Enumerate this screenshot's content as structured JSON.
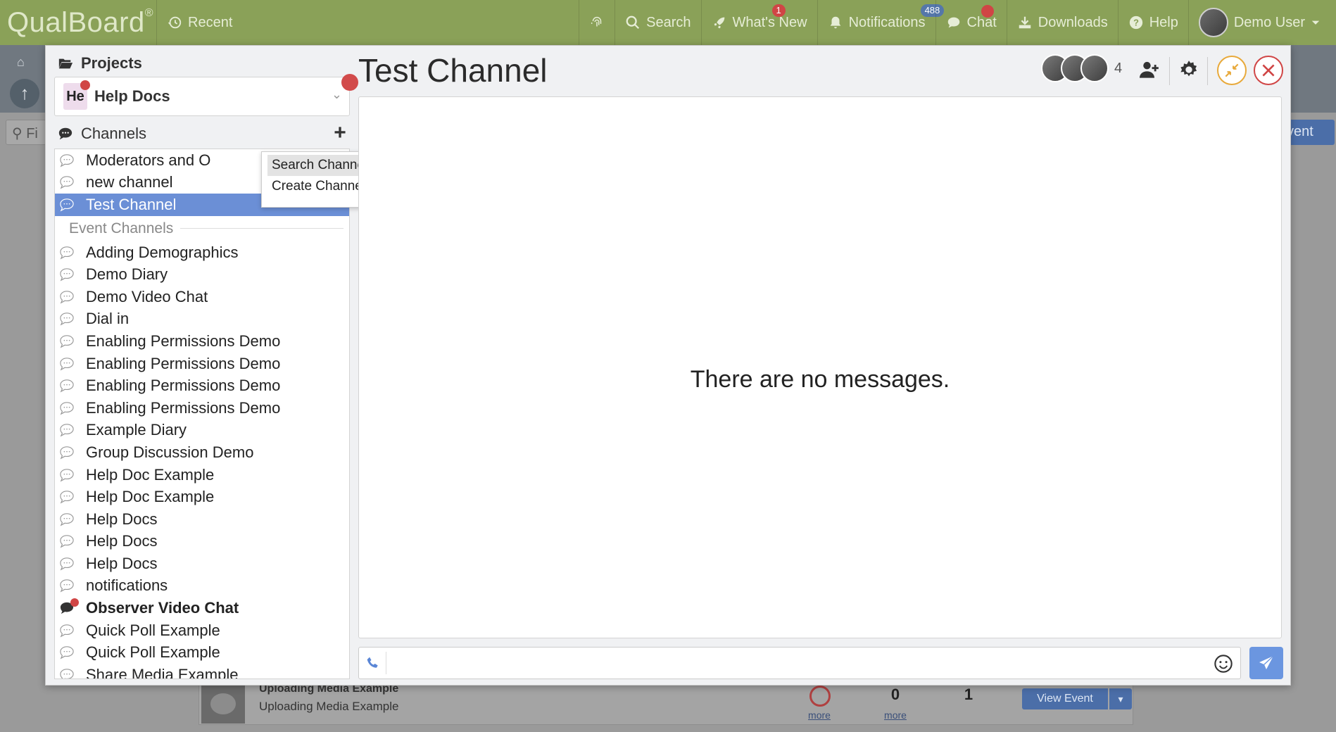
{
  "topbar": {
    "logo": "QualBoard",
    "logo_mark": "®",
    "recent": "Recent",
    "search": "Search",
    "whats_new": "What's New",
    "whats_new_badge": "1",
    "notifications": "Notifications",
    "notifications_badge": "488",
    "chat": "Chat",
    "downloads": "Downloads",
    "help": "Help",
    "user": "Demo User"
  },
  "background": {
    "filter_placeholder": "Fi",
    "event_button": "vent",
    "row_title": "Uploading Media Example",
    "row_subtitle": "Uploading Media Example",
    "count_a": "0",
    "count_b": "1",
    "more_1": "more",
    "more_2": "more",
    "view_event": "View Event"
  },
  "sidebar": {
    "projects_label": "Projects",
    "project_abbr": "He",
    "project_name": "Help Docs",
    "channels_label": "Channels",
    "channels": [
      {
        "label": "Moderators and O",
        "active": false
      },
      {
        "label": "new channel",
        "active": false
      },
      {
        "label": "Test Channel",
        "active": true
      }
    ],
    "event_channels_label": "Event Channels",
    "event_channels": [
      {
        "label": "Adding Demographics"
      },
      {
        "label": "Demo Diary"
      },
      {
        "label": "Demo Video Chat"
      },
      {
        "label": "Dial in"
      },
      {
        "label": "Enabling Permissions Demo"
      },
      {
        "label": "Enabling Permissions Demo"
      },
      {
        "label": "Enabling Permissions Demo"
      },
      {
        "label": "Enabling Permissions Demo"
      },
      {
        "label": "Example Diary"
      },
      {
        "label": "Group Discussion Demo"
      },
      {
        "label": "Help Doc Example"
      },
      {
        "label": "Help Doc Example"
      },
      {
        "label": "Help Docs"
      },
      {
        "label": "Help Docs"
      },
      {
        "label": "Help Docs"
      },
      {
        "label": "notifications"
      },
      {
        "label": "Observer Video Chat",
        "unread": true
      },
      {
        "label": "Quick Poll Example"
      },
      {
        "label": "Quick Poll Example"
      },
      {
        "label": "Share Media Example"
      }
    ]
  },
  "popup": {
    "search_channels": "Search Channels",
    "create_channel": "Create Channel"
  },
  "channel": {
    "title": "Test Channel",
    "member_count": "4",
    "empty_text": "There are no messages.",
    "message_placeholder": ""
  },
  "colors": {
    "topbar": "#8aa158",
    "active_channel": "#6b8fd6",
    "annotation_arrow": "#d884e6",
    "send_button": "#6b96e0"
  }
}
